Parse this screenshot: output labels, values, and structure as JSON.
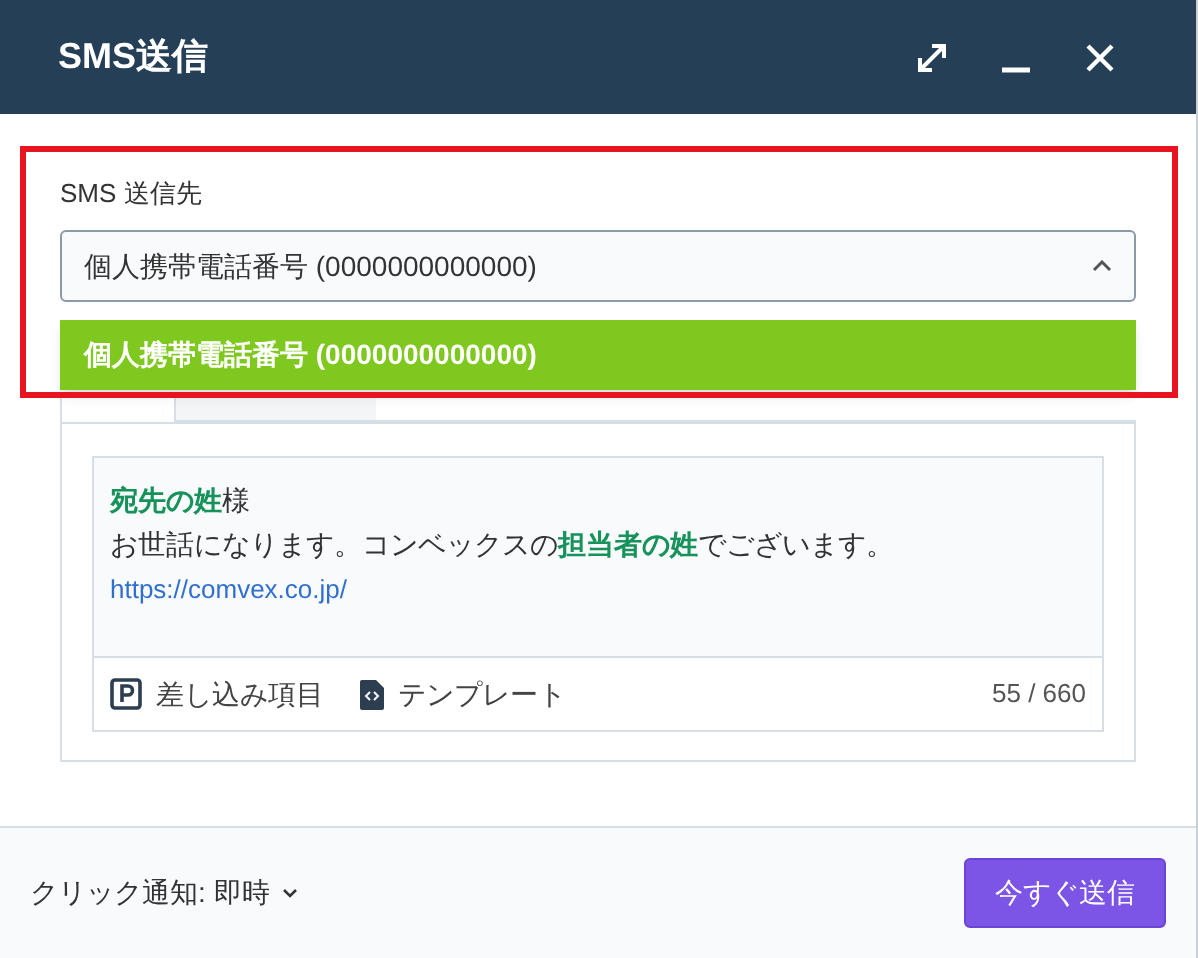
{
  "window": {
    "title": "SMS送信"
  },
  "recipient": {
    "label": "SMS 送信先",
    "value": "個人携帯電話番号 (0000000000000)",
    "expanded": true,
    "options": [
      {
        "label": "個人携帯電話番号 (0000000000000)",
        "selected": true
      }
    ]
  },
  "tabs": [
    {
      "selected": true
    },
    {
      "selected": false
    }
  ],
  "message": {
    "lines": [
      {
        "kind": "text",
        "text": "**宛先の姓**様"
      },
      {
        "kind": "text",
        "text": "お世話になります。コンベックスの**担当者の姓**でございます。"
      },
      {
        "kind": "link",
        "text": "https://comvex.co.jp/"
      }
    ],
    "tools": [
      {
        "kind": "merge",
        "label": "差し込み項目"
      },
      {
        "kind": "template",
        "label": "テンプレート"
      }
    ],
    "counter": "55 / 660"
  },
  "footer": {
    "notify": "クリック通知: 即時",
    "send_button": "今すぐ送信"
  },
  "highlight": true
}
